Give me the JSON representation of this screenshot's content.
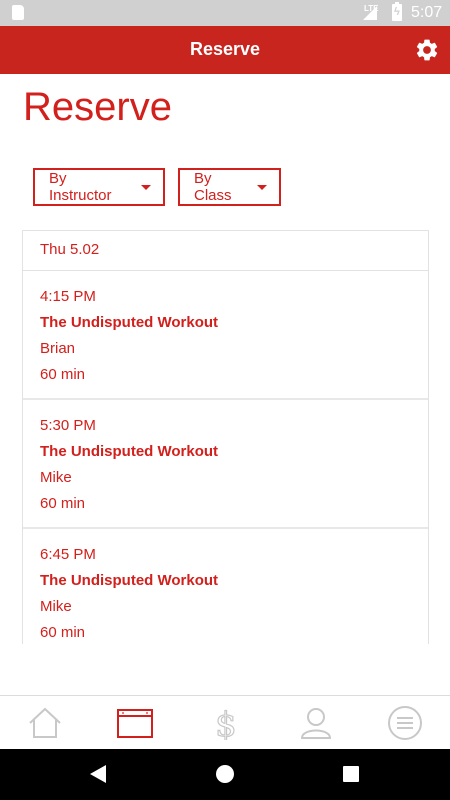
{
  "status_bar": {
    "network": "LTE",
    "time": "5:07"
  },
  "app_bar": {
    "title": "Reserve",
    "settings_icon": "gear-icon"
  },
  "page": {
    "title": "Reserve"
  },
  "filters": {
    "instructor_label": "By Instructor",
    "class_label": "By Class"
  },
  "schedule": {
    "date": "Thu 5.02",
    "sessions": [
      {
        "time": "4:15 PM",
        "class_name": "The Undisputed Workout",
        "instructor": "Brian",
        "duration": "60 min"
      },
      {
        "time": "5:30 PM",
        "class_name": "The Undisputed Workout",
        "instructor": "Mike",
        "duration": "60 min"
      },
      {
        "time": "6:45 PM",
        "class_name": "The Undisputed Workout",
        "instructor": "Mike",
        "duration": "60 min"
      }
    ]
  },
  "bottom_nav": {
    "items": [
      "home-icon",
      "calendar-icon",
      "dollar-icon",
      "profile-icon",
      "menu-icon"
    ],
    "active": "calendar-icon"
  },
  "colors": {
    "brand": "#c8251e",
    "accent": "#d2201c",
    "inactive": "#c8c8c8"
  }
}
